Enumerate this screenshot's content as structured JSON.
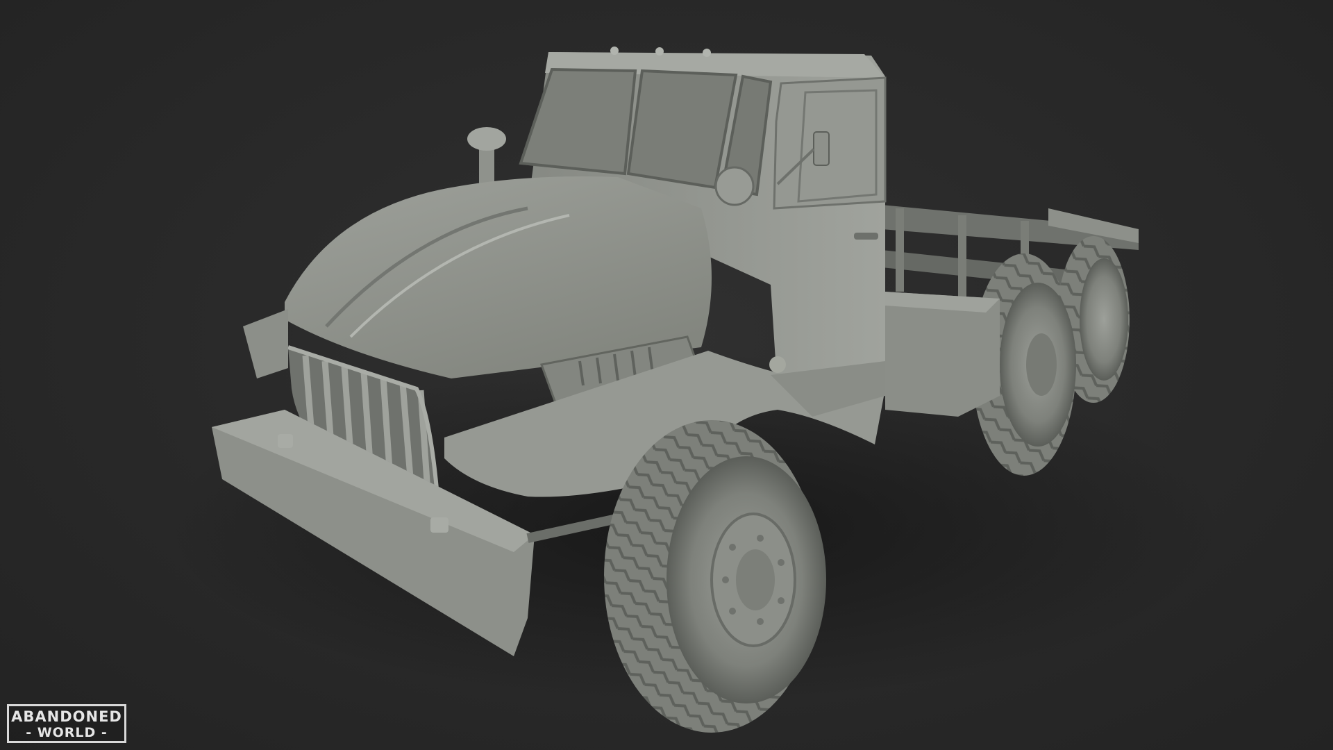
{
  "scene": {
    "background_color": "#2a2a2a",
    "model_color": "#8a8d88",
    "subject": "truck-model-render"
  },
  "watermark": {
    "line1": "ABANDONED",
    "line2": "- WORLD -"
  }
}
